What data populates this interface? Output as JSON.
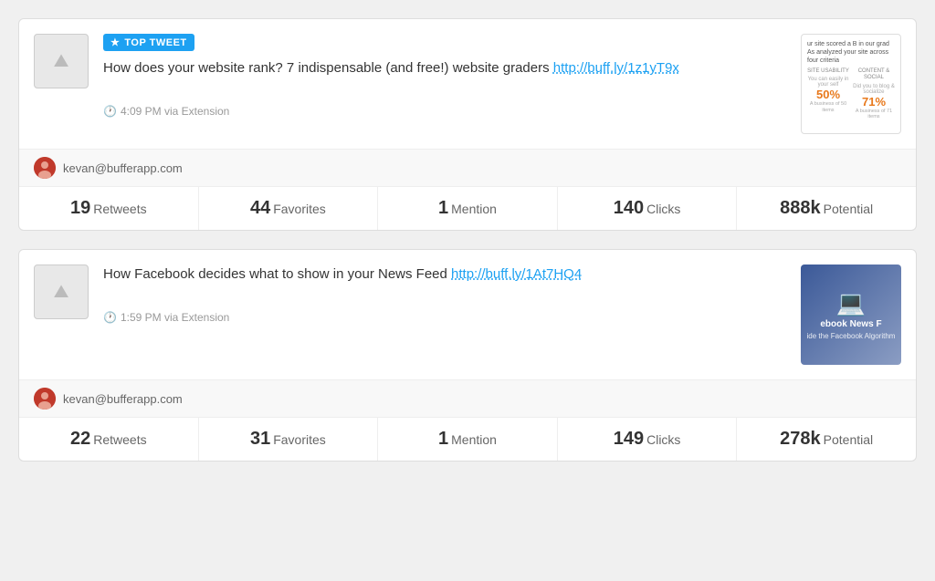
{
  "cards": [
    {
      "id": "card-1",
      "badge": "TOP TWEET",
      "text": "How does your website rank? 7 indispensable (and free!) website graders",
      "link": "http://buff.ly/1z1yT9x",
      "time": "4:09 PM via Extension",
      "author": "kevan@bufferapp.com",
      "thumb_type": "grader",
      "grader": {
        "title_line1": "ur site scored a B in our grad",
        "title_line2": "As analyzed your site across four criteria",
        "col1_label": "SITE USABILITY",
        "col1_sub": "You can easily in your self",
        "col1_percent": "50%",
        "col1_sub2": "A business of 50 items",
        "col2_label": "CONTENT & SOCIAL",
        "col2_sub": "Did you to blog & socialize",
        "col2_percent": "71%",
        "col2_sub2": "A business of 71 items"
      },
      "stats": [
        {
          "number": "19",
          "label": "Retweets"
        },
        {
          "number": "44",
          "label": "Favorites"
        },
        {
          "number": "1",
          "label": "Mention"
        },
        {
          "number": "140",
          "label": "Clicks"
        },
        {
          "number": "888k",
          "label": "Potential"
        }
      ]
    },
    {
      "id": "card-2",
      "badge": null,
      "text": "How Facebook decides what to show in your News Feed",
      "link": "http://buff.ly/1At7HQ4",
      "time": "1:59 PM via Extension",
      "author": "kevan@bufferapp.com",
      "thumb_type": "facebook",
      "stats": [
        {
          "number": "22",
          "label": "Retweets"
        },
        {
          "number": "31",
          "label": "Favorites"
        },
        {
          "number": "1",
          "label": "Mention"
        },
        {
          "number": "149",
          "label": "Clicks"
        },
        {
          "number": "278k",
          "label": "Potential"
        }
      ]
    }
  ],
  "icons": {
    "star": "★",
    "clock": "🕐",
    "image_placeholder": "🖼",
    "facebook": "f"
  }
}
